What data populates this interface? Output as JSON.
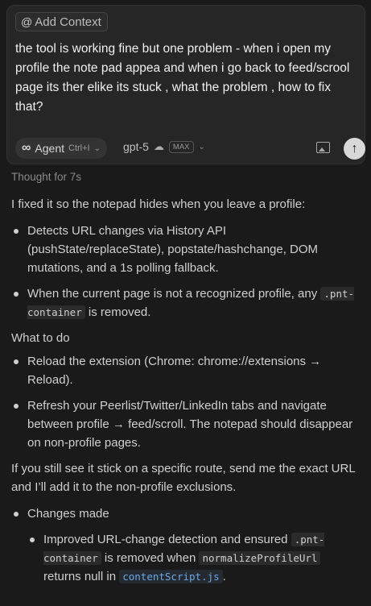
{
  "composer": {
    "context_chip": {
      "icon": "at-icon",
      "label": "Add Context"
    },
    "user_message": "the tool is working fine but one problem - when i open my profile the note pad appea and when i go back to feed/scrool page its ther elike its stuck , what the problem , how to fix that?",
    "toolbar": {
      "mode_label": "Agent",
      "mode_shortcut": "Ctrl+I",
      "model_label": "gpt-5",
      "model_badge": "MAX"
    }
  },
  "response": {
    "thought": "Thought for 7s",
    "intro": "I fixed it so the notepad hides when you leave a profile:",
    "fix_items": [
      "Detects URL changes via History API (pushState/replaceState), popstate/hashchange, DOM mutations, and a 1s polling fallback.",
      {
        "before": "When the current page is not a recognized profile, any ",
        "code": ".pnt-container",
        "after": " is removed."
      }
    ],
    "what_to_do_heading": "What to do",
    "todo_items": [
      "Reload the extension (Chrome: chrome://extensions → Reload).",
      "Refresh your Peerlist/Twitter/LinkedIn tabs and navigate between profile → feed/scroll. The notepad should disappear on non-profile pages."
    ],
    "followup": "If you still see it stick on a specific route, send me the exact URL and I’ll add it to the non-profile exclusions.",
    "changes_heading": "Changes made",
    "change_item": {
      "t1": "Improved URL-change detection and ensured ",
      "code1": ".pnt-container",
      "t2": " is removed when ",
      "code2": "normalizeProfileUrl",
      "t3": " returns null in ",
      "file": "contentScript.js",
      "t4": "."
    }
  }
}
